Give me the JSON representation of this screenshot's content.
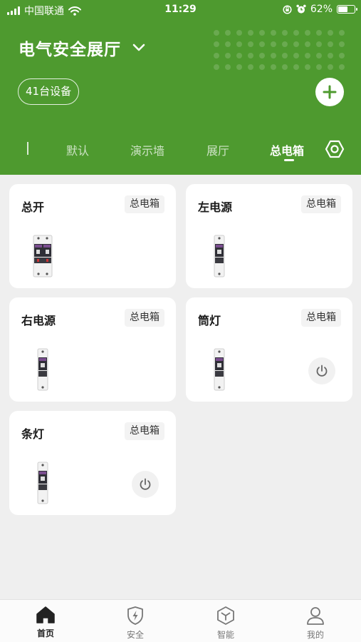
{
  "status_bar": {
    "carrier": "中国联通",
    "time": "11:29",
    "battery": "62%",
    "battery_level": 0.62
  },
  "header": {
    "title": "电气安全展厅",
    "device_count": "41台设备"
  },
  "tabs": [
    {
      "label": "默认",
      "active": false
    },
    {
      "label": "演示墙",
      "active": false
    },
    {
      "label": "展厅",
      "active": false
    },
    {
      "label": "总电箱",
      "active": true
    }
  ],
  "devices": [
    {
      "name": "总开",
      "group": "总电箱",
      "type": "double-breaker",
      "has_power_button": false
    },
    {
      "name": "左电源",
      "group": "总电箱",
      "type": "single-breaker",
      "has_power_button": false
    },
    {
      "name": "右电源",
      "group": "总电箱",
      "type": "single-breaker",
      "has_power_button": false
    },
    {
      "name": "筒灯",
      "group": "总电箱",
      "type": "single-breaker",
      "has_power_button": true
    },
    {
      "name": "条灯",
      "group": "总电箱",
      "type": "single-breaker",
      "has_power_button": true
    }
  ],
  "bottom_nav": [
    {
      "label": "首页",
      "icon": "home-icon",
      "active": true
    },
    {
      "label": "安全",
      "icon": "shield-bolt-icon",
      "active": false
    },
    {
      "label": "智能",
      "icon": "cube-icon",
      "active": false
    },
    {
      "label": "我的",
      "icon": "user-icon",
      "active": false
    }
  ],
  "colors": {
    "brand_green": "#4e9a2f",
    "background": "#efefef",
    "card": "#ffffff"
  }
}
